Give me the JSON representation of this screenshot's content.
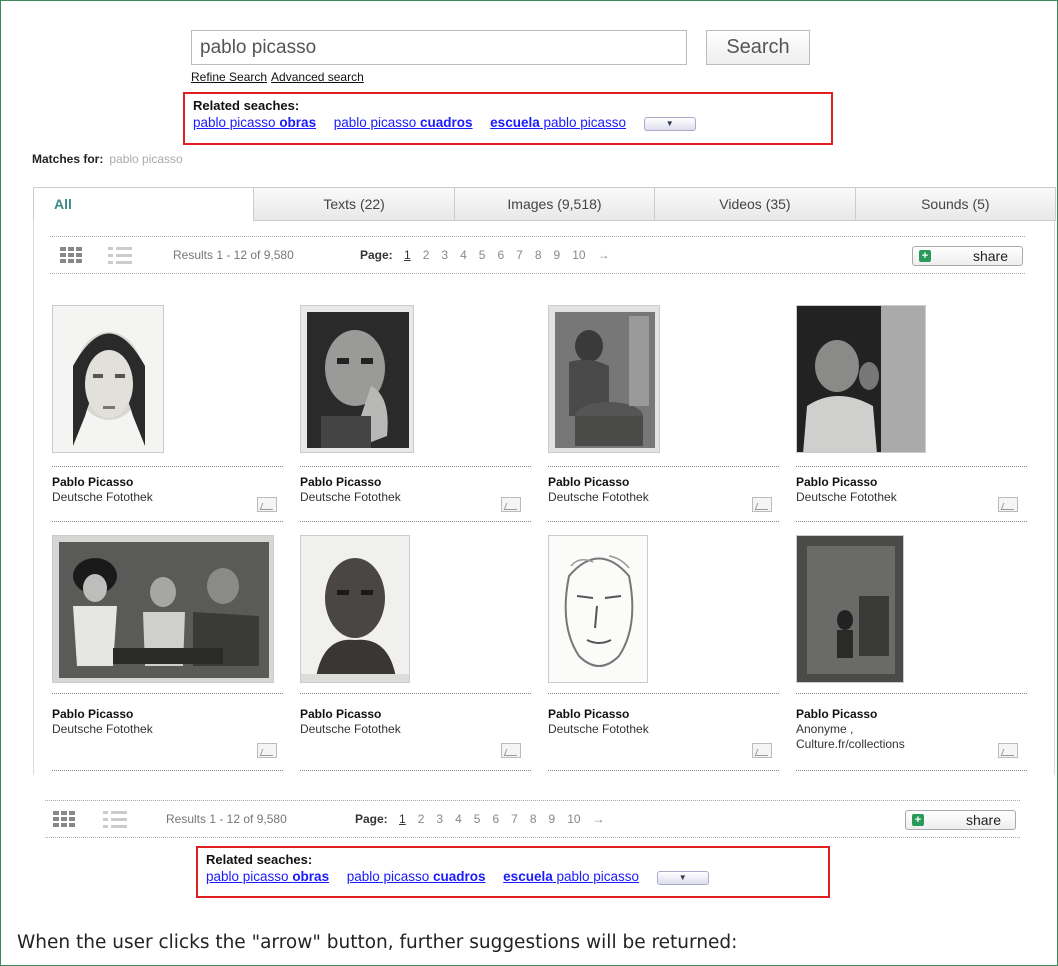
{
  "search": {
    "value": "pablo picasso",
    "button_label": "Search"
  },
  "refine": {
    "refine_label": "Refine Search",
    "advanced_label": "Advanced search"
  },
  "related_top": {
    "title": "Related seaches:",
    "links": [
      {
        "plain": "pablo picasso ",
        "bold": "obras"
      },
      {
        "plain": "pablo picasso ",
        "bold": "cuadros"
      },
      {
        "bold": "escuela",
        "plain": " pablo picasso"
      }
    ]
  },
  "matches": {
    "label": "Matches for:",
    "query": "pablo picasso"
  },
  "tabs": [
    {
      "label": "All"
    },
    {
      "label": "Texts (22)"
    },
    {
      "label": "Images (9,518)"
    },
    {
      "label": "Videos (35)"
    },
    {
      "label": "Sounds (5)"
    }
  ],
  "results": {
    "summary": "Results 1 - 12 of 9,580",
    "page_label": "Page:",
    "pages": [
      "1",
      "2",
      "3",
      "4",
      "5",
      "6",
      "7",
      "8",
      "9",
      "10",
      "→"
    ],
    "share_label": "share"
  },
  "cards": [
    {
      "title": "Pablo Picasso",
      "source": "Deutsche Fotothek"
    },
    {
      "title": "Pablo Picasso",
      "source": "Deutsche Fotothek"
    },
    {
      "title": "Pablo Picasso",
      "source": "Deutsche Fotothek"
    },
    {
      "title": "Pablo Picasso",
      "source": "Deutsche Fotothek"
    },
    {
      "title": "Pablo Picasso",
      "source": "Deutsche Fotothek"
    },
    {
      "title": "Pablo Picasso",
      "source": "Deutsche Fotothek"
    },
    {
      "title": "Pablo Picasso",
      "source": "Deutsche Fotothek"
    },
    {
      "title": "Pablo Picasso",
      "source": "Anonyme ,",
      "source2": "Culture.fr/collections"
    }
  ],
  "related_bottom": {
    "title": "Related seaches:",
    "links": [
      {
        "plain": "pablo picasso ",
        "bold": "obras"
      },
      {
        "plain": "pablo picasso ",
        "bold": "cuadros"
      },
      {
        "bold": "escuela",
        "plain": " pablo picasso"
      }
    ]
  },
  "caption": "When the user clicks the \"arrow\" button, further suggestions will be returned:",
  "icons": {
    "grid": "grid-view-icon",
    "list": "list-view-icon",
    "plus": "plus-icon",
    "image": "image-type-icon",
    "dropdown": "chevron-down-icon"
  }
}
